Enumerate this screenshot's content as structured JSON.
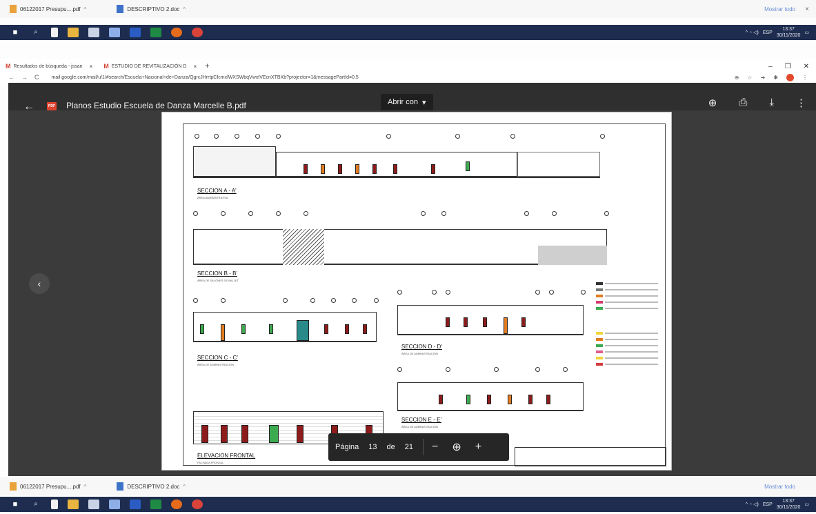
{
  "downloads_top": {
    "items": [
      {
        "label": "06122017 Presupu....pdf"
      },
      {
        "label": "DESCRIPTIVO 2.doc"
      }
    ],
    "show_all": "Mostrar todo",
    "close": "×"
  },
  "downloads_bottom": {
    "items": [
      {
        "label": "06122017 Presupu....pdf"
      },
      {
        "label": "DESCRIPTIVO 2.doc"
      }
    ],
    "show_all": "Mostrar todo"
  },
  "taskbar": {
    "language": "ESP",
    "time_top": "13:37",
    "date_top": "30/11/2020",
    "time_bottom": "13:37",
    "date_bottom": "30/11/2020"
  },
  "browser": {
    "tabs": [
      {
        "label": "Resultados de búsqueda - jssan",
        "close": "×"
      },
      {
        "label": "ESTUDIO DE REVITALIZACIÓN D",
        "close": "×"
      }
    ],
    "new_tab": "+",
    "url": "mail.google.com/mail/u/1/#search/Escuela+Nacional+de+Danza/QgrcJHrrtpCfcmxlWXSWbqVwxtVEcnXTBXb?projector=1&messagePartId=0.5"
  },
  "viewer": {
    "document_title": "Planos Estudio Escuela de Danza Marcelle B.pdf",
    "open_with": "Abrir con",
    "page_label": "Página",
    "current_page": "13",
    "of_label": "de",
    "total_pages": "21"
  },
  "drawing": {
    "sections": [
      {
        "title": "SECCION A - A'",
        "subtitle": "ÁREA ADMINISTRATIVA"
      },
      {
        "title": "SECCION B - B'",
        "subtitle": "ÁREA DE SALONES DE BALLET"
      },
      {
        "title": "SECCION C - C'",
        "subtitle": "ÁREA DE ADMINISTRACIÓN"
      },
      {
        "title": "SECCION D - D'",
        "subtitle": "ÁREA DE ADMINISTRACIÓN"
      },
      {
        "title": "SECCION E - E'",
        "subtitle": "ÁREA DE ADMINISTRACIÓN"
      },
      {
        "title": "ELEVACION FRONTAL",
        "subtitle": "FACHADA FRONTAL"
      }
    ]
  },
  "colors": {
    "taskbar": "#1e2d4f",
    "viewer_bg": "#3b3b3b",
    "door_orange": "#e07b1f",
    "window_red": "#8e1b1b",
    "green": "#3caa4f"
  }
}
